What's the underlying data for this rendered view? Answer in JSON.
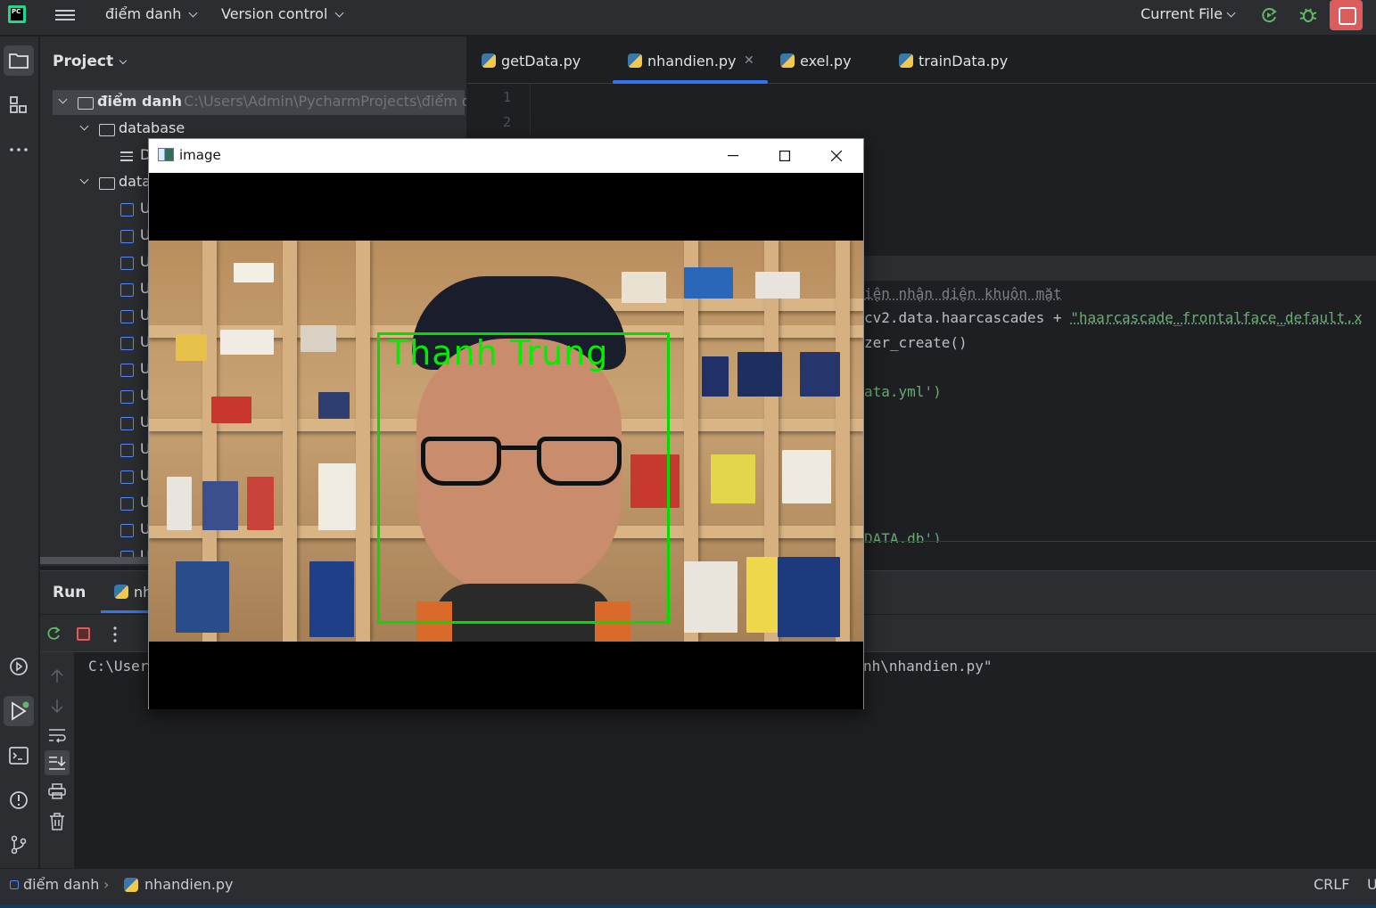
{
  "toolbar": {
    "app_logo": "PC",
    "project_name": "điểm danh",
    "vcs_label": "Version control",
    "run_config": "Current File"
  },
  "project_panel": {
    "title": "Project",
    "root": {
      "name": "điểm danh",
      "path": "C:\\Users\\Admin\\PycharmProjects\\điểm d"
    },
    "items": [
      {
        "label": "database"
      },
      {
        "label": "D"
      },
      {
        "label": "data"
      },
      {
        "label": "U"
      }
    ]
  },
  "editor": {
    "tabs": [
      {
        "label": "getData.py"
      },
      {
        "label": "nhandien.py"
      },
      {
        "label": "exel.py"
      },
      {
        "label": "trainData.py"
      }
    ],
    "line_numbers": [
      "1",
      "2"
    ],
    "code": {
      "l1": "iện nhận diện khuôn mặt",
      "l2a": "cv2.data.haarcascades + ",
      "l2b": "\"haarcascade_frontalface_default.x",
      "l3": "zer_create()",
      "l4": "ata.yml')",
      "l5": "DATA.db')"
    }
  },
  "run_panel": {
    "title": "Run",
    "tab_label": "nh",
    "console_left": "C:\\User",
    "console_right": "nh\\nhandien.py\""
  },
  "cv_window": {
    "title": "image",
    "face_label": "Thanh Trung"
  },
  "status_bar": {
    "crumb_project": "điểm danh",
    "crumb_file": "nhandien.py",
    "line_sep": "CRLF",
    "encoding": "U"
  },
  "colors": {
    "accent": "#3574f0",
    "stop": "#db5c5c",
    "face_box": "#00dd00"
  }
}
